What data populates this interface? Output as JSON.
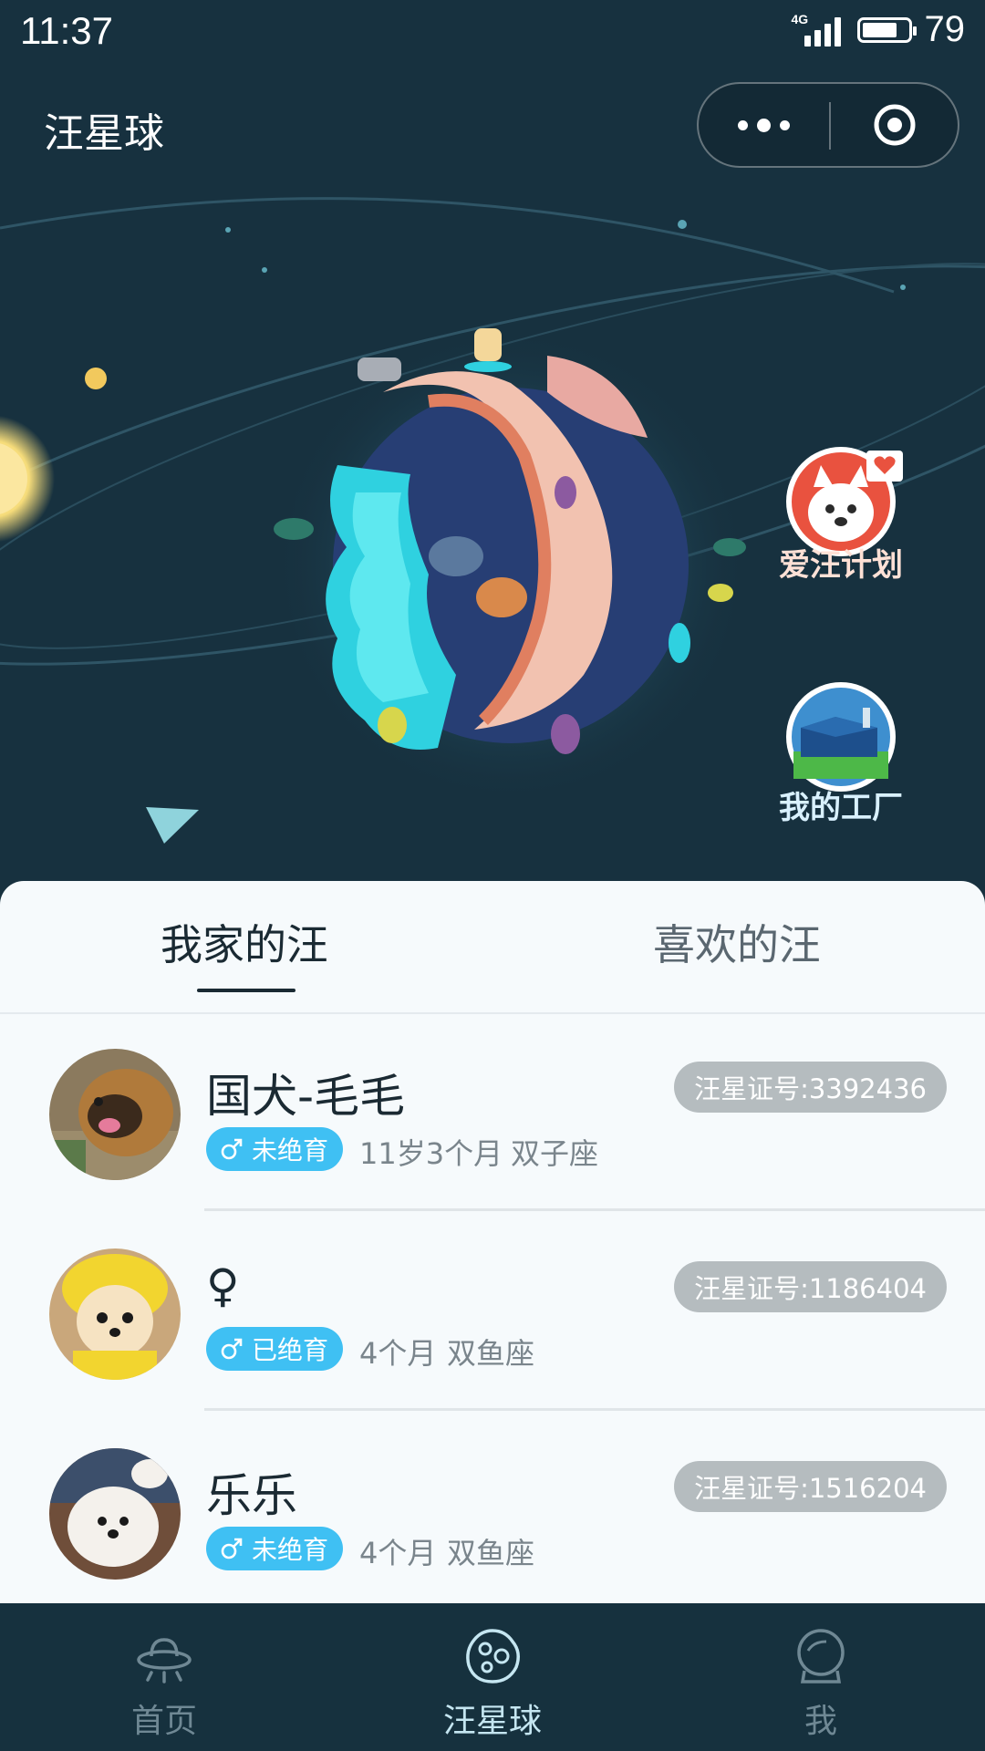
{
  "status_bar": {
    "time": "11:37",
    "network": "4G",
    "battery": "79",
    "battery_level_percent": 79
  },
  "nav": {
    "title": "汪星球"
  },
  "hero": {
    "side_buttons": [
      {
        "label": "爱汪计划"
      },
      {
        "label": "我的工厂"
      }
    ]
  },
  "tabs": [
    {
      "label": "我家的汪",
      "active": true
    },
    {
      "label": "喜欢的汪",
      "active": false
    }
  ],
  "dogs": [
    {
      "name": "国犬-毛毛",
      "neuter": "未绝育",
      "age": "11岁3个月",
      "zodiac": "双子座",
      "id": "汪星证号:3392436"
    },
    {
      "name": "♀",
      "neuter": "已绝育",
      "age": "4个月",
      "zodiac": "双鱼座",
      "id": "汪星证号:1186404"
    },
    {
      "name": "乐乐",
      "neuter": "未绝育",
      "age": "4个月",
      "zodiac": "双鱼座",
      "id": "汪星证号:1516204"
    }
  ],
  "tabbar": [
    {
      "label": "首页",
      "icon": "ufo-icon",
      "active": false
    },
    {
      "label": "汪星球",
      "icon": "planet-icon",
      "active": true
    },
    {
      "label": "我",
      "icon": "astronaut-helmet-icon",
      "active": false
    }
  ],
  "colors": {
    "background": "#17313f",
    "accent": "#3fc0f3",
    "id_pill": "#b5bcbf"
  }
}
